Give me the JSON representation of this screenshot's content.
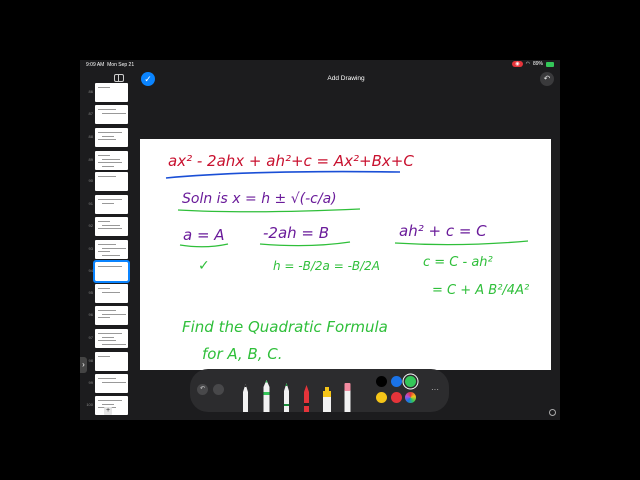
{
  "status_bar": {
    "time": "9:09 AM",
    "date": "Mon Sep 21",
    "battery": "89%"
  },
  "header": {
    "title": "Add Drawing",
    "done_icon": "✓",
    "undo_icon": "↶"
  },
  "sidebar": {
    "pages": [
      {
        "label": "86"
      },
      {
        "label": "87"
      },
      {
        "label": "88"
      },
      {
        "label": "89"
      },
      {
        "label": "90"
      },
      {
        "label": "91"
      },
      {
        "label": "92"
      },
      {
        "label": "93"
      },
      {
        "label": "94"
      },
      {
        "label": "95"
      },
      {
        "label": "96"
      },
      {
        "label": "97"
      },
      {
        "label": "98"
      },
      {
        "label": "99"
      },
      {
        "label": "100"
      }
    ],
    "add_label": "+"
  },
  "drawing": {
    "line1": "ax² - 2ahx + ah²+c = Ax²+Bx+C",
    "line2": "Soln is x = h ± √(-c/a)",
    "eq_a": "a = A",
    "check": "✓",
    "eq_b": "-2ah = B",
    "eq_h": "h = -B/2a = -B/2A",
    "eq_c1": "ah² + c = C",
    "eq_c2": "c = C - ah²",
    "eq_c3": "= C + A B²/4A²",
    "task1": "Find the Quadratic Formula",
    "task2": "for A, B, C."
  },
  "toolbar": {
    "more_label": "···",
    "colors": [
      "#000000",
      "#1a73e8",
      "#34c759",
      "#f5c518",
      "#e5343a"
    ]
  },
  "colors": {
    "ink_red": "#c8102e",
    "ink_purple": "#6a1b9a",
    "ink_green": "#2fbf3a",
    "ink_blue": "#1a4fd6"
  }
}
